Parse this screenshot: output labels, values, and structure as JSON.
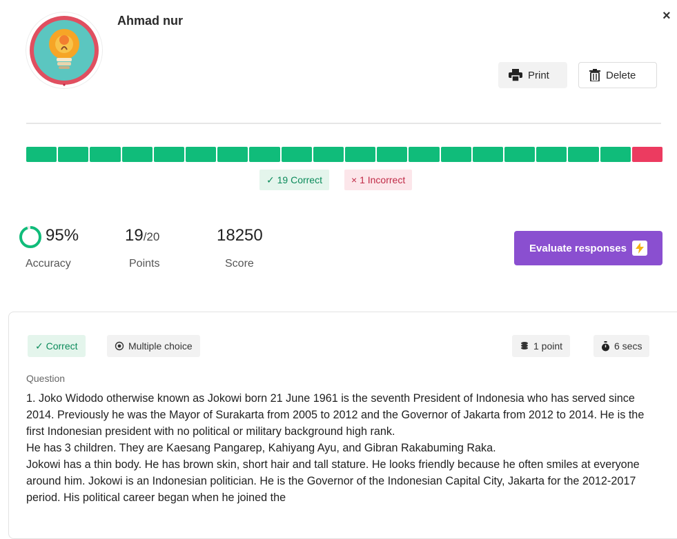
{
  "user": {
    "name": "Ahmad nur"
  },
  "toolbar": {
    "print_label": "Print",
    "delete_label": "Delete",
    "close_glyph": "×"
  },
  "summary": {
    "segments": [
      "correct",
      "correct",
      "correct",
      "correct",
      "correct",
      "correct",
      "correct",
      "correct",
      "correct",
      "correct",
      "correct",
      "correct",
      "correct",
      "correct",
      "correct",
      "correct",
      "correct",
      "correct",
      "correct",
      "incorrect"
    ],
    "correct_label": "✓ 19 Correct",
    "incorrect_label": "× 1 Incorrect"
  },
  "stats": {
    "accuracy_value": "95%",
    "accuracy_label": "Accuracy",
    "accuracy_fraction": 0.95,
    "points_value": "19",
    "points_total": "/20",
    "points_label": "Points",
    "score_value": "18250",
    "score_label": "Score"
  },
  "evaluate": {
    "label": "Evaluate responses"
  },
  "question": {
    "status_label": "✓ Correct",
    "type_label": "Multiple choice",
    "points_label": "1 point",
    "time_label": "6 secs",
    "heading": "Question",
    "paragraphs": [
      "1. Joko Widodo otherwise known as Jokowi born 21 June 1961 is the seventh President of Indonesia who has served since 2014. Previously he was the Mayor of Surakarta from 2005 to 2012 and the Governor of Jakarta from 2012 to 2014. He is the first Indonesian president with no political or military background high rank.",
      "He has 3 children. They are Kaesang Pangarep, Kahiyang Ayu, and Gibran Rakabuming Raka.",
      "Jokowi has a thin body. He has brown skin, short hair and tall stature. He looks friendly because he often smiles at everyone around him. Jokowi is an Indonesian politician. He is the Governor of the Indonesian Capital City, Jakarta for the 2012-2017 period. His political career began when he joined the"
    ]
  },
  "colors": {
    "correct": "#10bc7a",
    "incorrect": "#ec3b60",
    "accent": "#8a4fd0",
    "bolt": "#f5b316"
  },
  "icons": {
    "avatar": "lightbulb-avatar-icon",
    "print": "printer-icon",
    "delete": "trash-icon",
    "type": "radio-icon",
    "points": "coins-icon",
    "time": "stopwatch-icon",
    "evaluate": "bolt-icon"
  }
}
